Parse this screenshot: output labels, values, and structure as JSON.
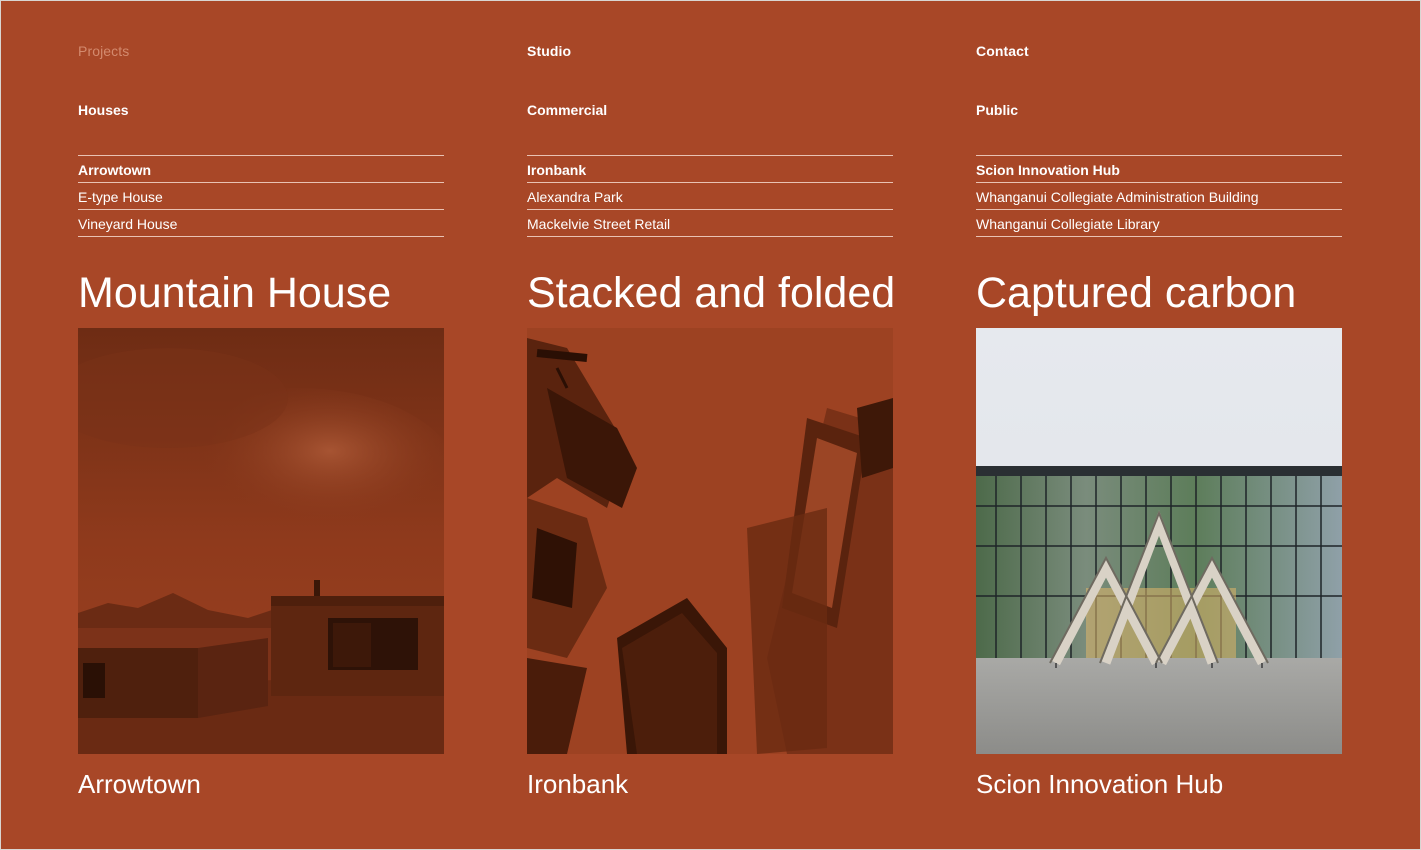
{
  "nav": {
    "projects": "Projects",
    "studio": "Studio",
    "contact": "Contact"
  },
  "columns": [
    {
      "category": "Houses",
      "items": [
        "Arrowtown",
        "E-type House",
        "Vineyard House"
      ],
      "headline": "Mountain House",
      "caption": "Arrowtown"
    },
    {
      "category": "Commercial",
      "items": [
        "Ironbank",
        "Alexandra Park",
        "Mackelvie Street Retail"
      ],
      "headline": "Stacked and folded",
      "caption": "Ironbank"
    },
    {
      "category": "Public",
      "items": [
        "Scion Innovation Hub",
        "Whanganui Collegiate Administration Building",
        "Whanganui Collegiate Library"
      ],
      "headline": "Captured carbon",
      "caption": "Scion Innovation Hub"
    }
  ],
  "colors": {
    "background": "#a84727",
    "text": "#ffffff",
    "dim_text": "#d38a6e",
    "rule": "#e9c2b3"
  }
}
